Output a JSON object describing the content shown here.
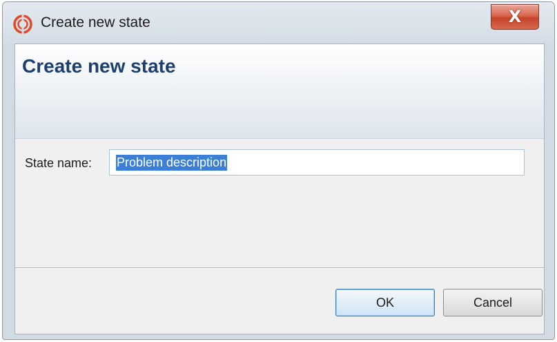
{
  "window": {
    "title": "Create new state",
    "close_label": "X"
  },
  "banner": {
    "title": "Create new state"
  },
  "form": {
    "state_name_label": "State name:",
    "state_name_value": "Problem description"
  },
  "buttons": {
    "ok_label": "OK",
    "cancel_label": "Cancel"
  },
  "colors": {
    "banner_title": "#1d3f70",
    "selection": "#3c7fd6",
    "close_button": "#c5432a"
  },
  "icons": {
    "app": "app-logo-icon",
    "close": "close-icon"
  }
}
